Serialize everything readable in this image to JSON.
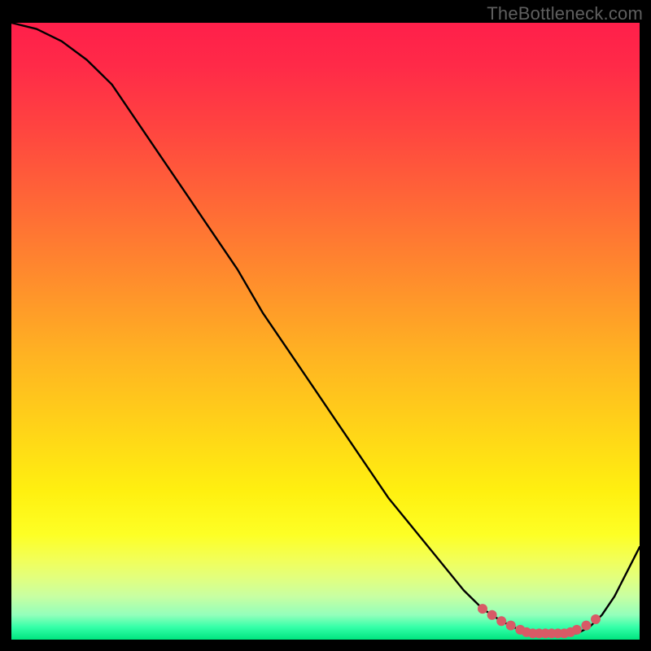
{
  "watermark": "TheBottleneck.com",
  "chart_data": {
    "type": "line",
    "title": "",
    "xlabel": "",
    "ylabel": "",
    "xlim": [
      0,
      100
    ],
    "ylim": [
      0,
      100
    ],
    "grid": false,
    "legend": false,
    "annotations": [],
    "series": [
      {
        "name": "curve",
        "color": "#000000",
        "x": [
          0,
          4,
          8,
          12,
          16,
          20,
          24,
          28,
          32,
          36,
          40,
          44,
          48,
          52,
          56,
          60,
          64,
          68,
          72,
          75,
          78,
          80,
          82,
          84,
          86,
          88,
          90,
          92,
          94,
          96,
          98,
          100
        ],
        "y": [
          100,
          99,
          97,
          94,
          90,
          84,
          78,
          72,
          66,
          60,
          53,
          47,
          41,
          35,
          29,
          23,
          18,
          13,
          8,
          5,
          3,
          2,
          1,
          1,
          1,
          1,
          1,
          2,
          4,
          7,
          11,
          15
        ]
      }
    ],
    "markers": {
      "name": "bottom-cluster",
      "color": "#d85a66",
      "radius_px": 6,
      "x": [
        75,
        76.5,
        78,
        79.5,
        81,
        82,
        83,
        84,
        85,
        86,
        87,
        88,
        89,
        90,
        91.5,
        93
      ],
      "y": [
        5,
        4,
        3,
        2.3,
        1.6,
        1.2,
        1,
        1,
        1,
        1,
        1,
        1,
        1.2,
        1.6,
        2.3,
        3.3
      ]
    },
    "gradient_stops": [
      {
        "pos": 0.0,
        "color": "#ff1f4a"
      },
      {
        "pos": 0.3,
        "color": "#ff6a36"
      },
      {
        "pos": 0.66,
        "color": "#ffd418"
      },
      {
        "pos": 0.83,
        "color": "#fdff25"
      },
      {
        "pos": 1.0,
        "color": "#00e57f"
      }
    ]
  }
}
